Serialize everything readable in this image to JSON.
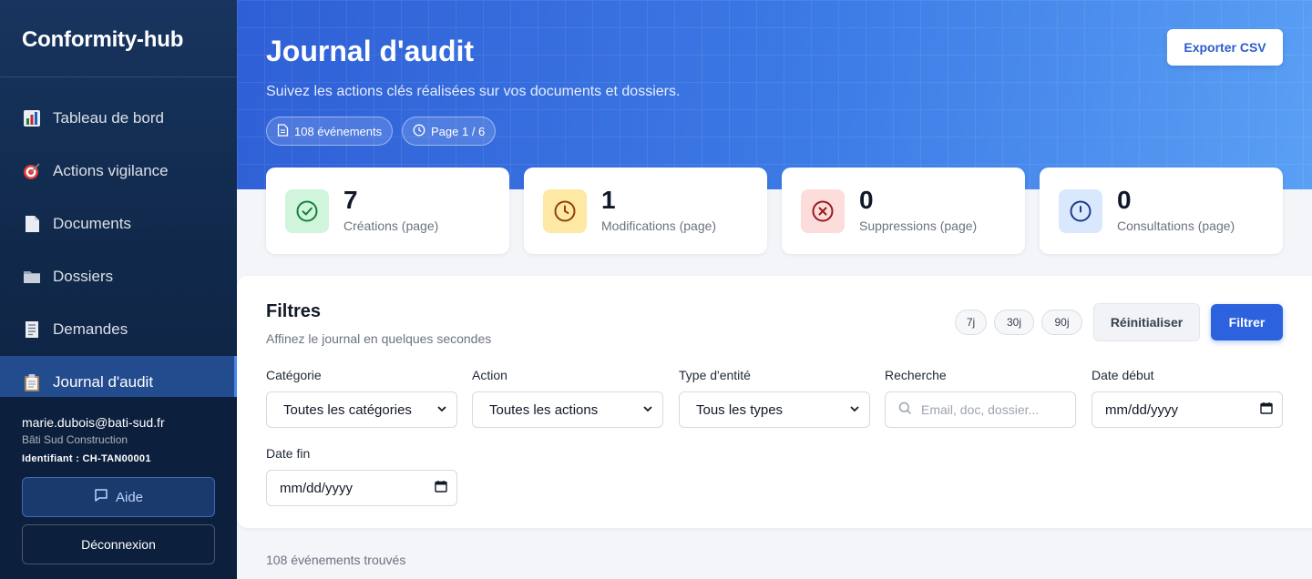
{
  "app": {
    "name": "Conformity-hub"
  },
  "sidebar": {
    "items": [
      {
        "label": "Tableau de bord",
        "icon": "bar-chart-icon"
      },
      {
        "label": "Actions vigilance",
        "icon": "target-icon"
      },
      {
        "label": "Documents",
        "icon": "document-icon"
      },
      {
        "label": "Dossiers",
        "icon": "folder-icon"
      },
      {
        "label": "Demandes",
        "icon": "receipt-icon"
      },
      {
        "label": "Journal d'audit",
        "icon": "clipboard-icon",
        "active": true
      }
    ],
    "user": {
      "email": "marie.dubois@bati-sud.fr",
      "company": "Bâti Sud Construction",
      "identifier": "Identifiant : CH-TAN00001"
    },
    "help_label": "Aide",
    "logout_label": "Déconnexion"
  },
  "header": {
    "title": "Journal d'audit",
    "subtitle": "Suivez les actions clés réalisées sur vos documents et dossiers.",
    "events_pill": "108 événements",
    "page_pill": "Page 1 / 6",
    "export_label": "Exporter CSV"
  },
  "stats": [
    {
      "value": "7",
      "label": "Créations (page)",
      "icon": "check-circle-icon",
      "bg": "#d1f5dc",
      "color": "#16a34a"
    },
    {
      "value": "1",
      "label": "Modifications (page)",
      "icon": "clock-icon",
      "bg": "#fde9a4",
      "color": "#b45309"
    },
    {
      "value": "0",
      "label": "Suppressions (page)",
      "icon": "x-circle-icon",
      "bg": "#fddcdc",
      "color": "#b91c1c"
    },
    {
      "value": "0",
      "label": "Consultations (page)",
      "icon": "info-circle-icon",
      "bg": "#d9e8fd",
      "color": "#1d4ed8"
    }
  ],
  "filters": {
    "title": "Filtres",
    "subtitle": "Affinez le journal en quelques secondes",
    "presets": [
      "7j",
      "30j",
      "90j"
    ],
    "reset_label": "Réinitialiser",
    "filter_label": "Filtrer",
    "category": {
      "label": "Catégorie",
      "value": "Toutes les catégories"
    },
    "action": {
      "label": "Action",
      "value": "Toutes les actions"
    },
    "entity_type": {
      "label": "Type d'entité",
      "value": "Tous les types"
    },
    "search": {
      "label": "Recherche",
      "placeholder": "Email, doc, dossier..."
    },
    "date_start": {
      "label": "Date début",
      "value": "mm/dd/yyyy"
    },
    "date_end": {
      "label": "Date fin",
      "value": "mm/dd/yyyy"
    }
  },
  "results": {
    "count_text": "108 événements trouvés"
  },
  "colors": {
    "accent": "#2c62dd",
    "sidebar": "#10284a"
  }
}
